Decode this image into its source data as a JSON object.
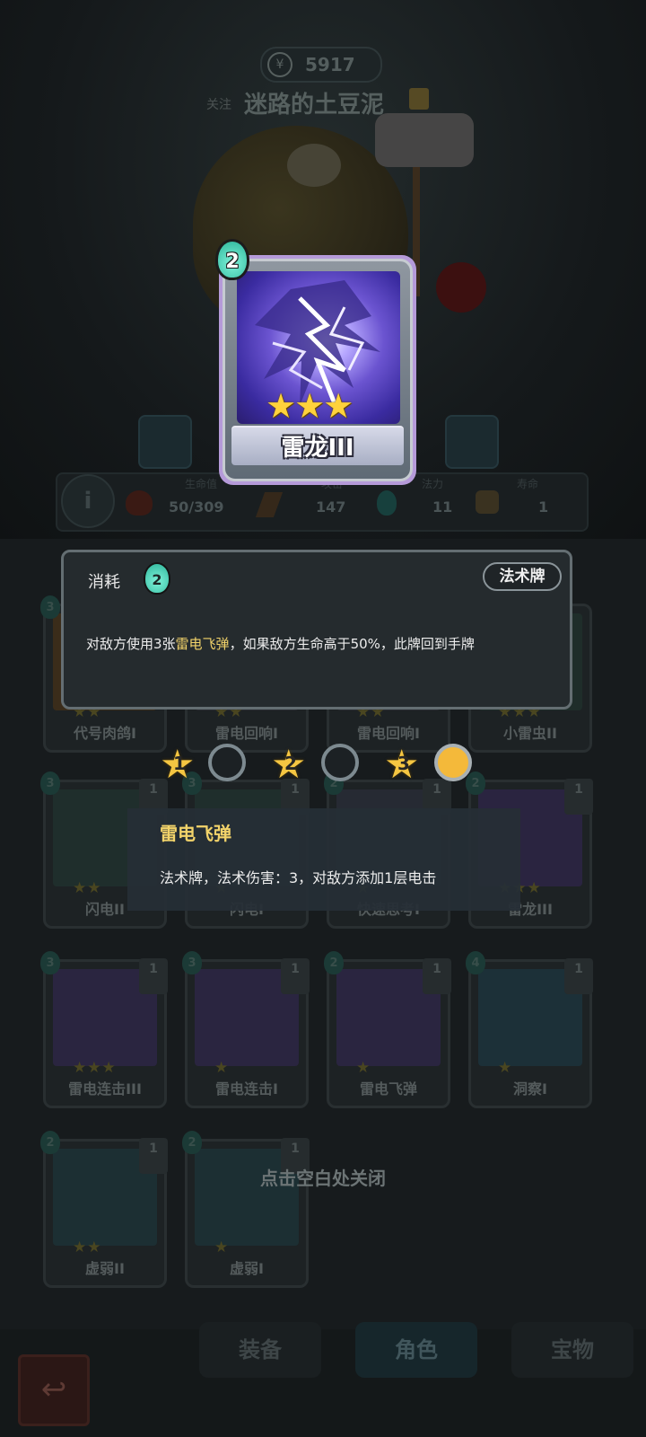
{
  "header": {
    "coins": "5917",
    "follow_label": "关注",
    "player_name": "迷路的土豆泥"
  },
  "stats": {
    "labels": {
      "hp": "生命值",
      "attack": "攻击",
      "mana": "法力",
      "lives": "寿命"
    },
    "hp": "50/309",
    "attack": "147",
    "mana": "11",
    "lives": "1"
  },
  "featured_card": {
    "name": "雷龙III",
    "cost": "2",
    "stars": 3
  },
  "popup": {
    "consume_label": "消耗",
    "consume_value": "2",
    "card_type": "法术牌",
    "description_before": "对敌方使用3张",
    "description_keyword": "雷电飞弹",
    "description_after": "，如果敌方生命高于50%，此牌回到手牌"
  },
  "levels": {
    "items": [
      "1",
      "2",
      "3"
    ],
    "selected": 3
  },
  "keyword_tooltip": {
    "title": "雷电飞弹",
    "description": "法术牌，法术伤害：3，对敌方添加1层电击"
  },
  "cards": [
    {
      "name": "代号肉鸽I",
      "cost": "3"
    },
    {
      "name": "雷电回响I",
      "cost": ""
    },
    {
      "name": "雷电回响I",
      "cost": ""
    },
    {
      "name": "小雷虫II",
      "cost": ""
    },
    {
      "name": "闪电II",
      "cost": "3",
      "count": "1"
    },
    {
      "name": "闪电I",
      "cost": "3",
      "count": "1"
    },
    {
      "name": "快速思考I",
      "cost": "2",
      "count": "1"
    },
    {
      "name": "雷龙III",
      "cost": "2",
      "count": "1"
    },
    {
      "name": "雷电连击III",
      "cost": "3",
      "count": "1"
    },
    {
      "name": "雷电连击I",
      "cost": "3",
      "count": "1"
    },
    {
      "name": "雷电飞弹",
      "cost": "2",
      "count": "1"
    },
    {
      "name": "洞察I",
      "cost": "4",
      "count": "1"
    },
    {
      "name": "虚弱II",
      "cost": "2",
      "count": "1"
    },
    {
      "name": "虚弱I",
      "cost": "2",
      "count": "1"
    }
  ],
  "close_hint": "点击空白处关闭",
  "tabs": {
    "equipment": "装备",
    "character": "角色",
    "treasure": "宝物"
  },
  "colors": {
    "highlight_gold": "#f2d36a",
    "mana_teal": "#2cb59a",
    "star_gold": "#f5c642"
  }
}
